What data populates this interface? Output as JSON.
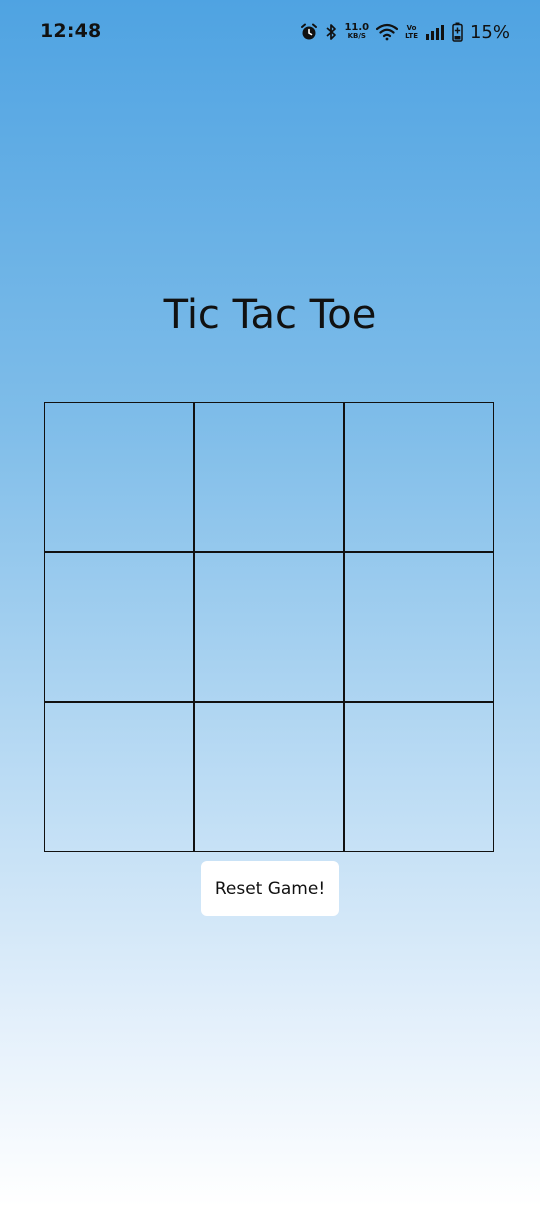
{
  "status_bar": {
    "time": "12:48",
    "net_speed_value": "11.0",
    "net_speed_unit": "KB/S",
    "volte_top": "Vo",
    "volte_bottom": "LTE",
    "battery_percent": "15%",
    "icons": [
      "alarm-icon",
      "bluetooth-icon",
      "wifi-icon",
      "signal-icon",
      "battery-charging-icon"
    ]
  },
  "game": {
    "title": "Tic Tac Toe",
    "board": [
      "",
      "",
      "",
      "",
      "",
      "",
      "",
      "",
      ""
    ],
    "reset_label": "Reset Game!"
  },
  "colors": {
    "background_top": "#4fa3e2",
    "background_bottom": "#ffffff",
    "grid_line": "#111111",
    "button_bg": "#ffffff"
  }
}
